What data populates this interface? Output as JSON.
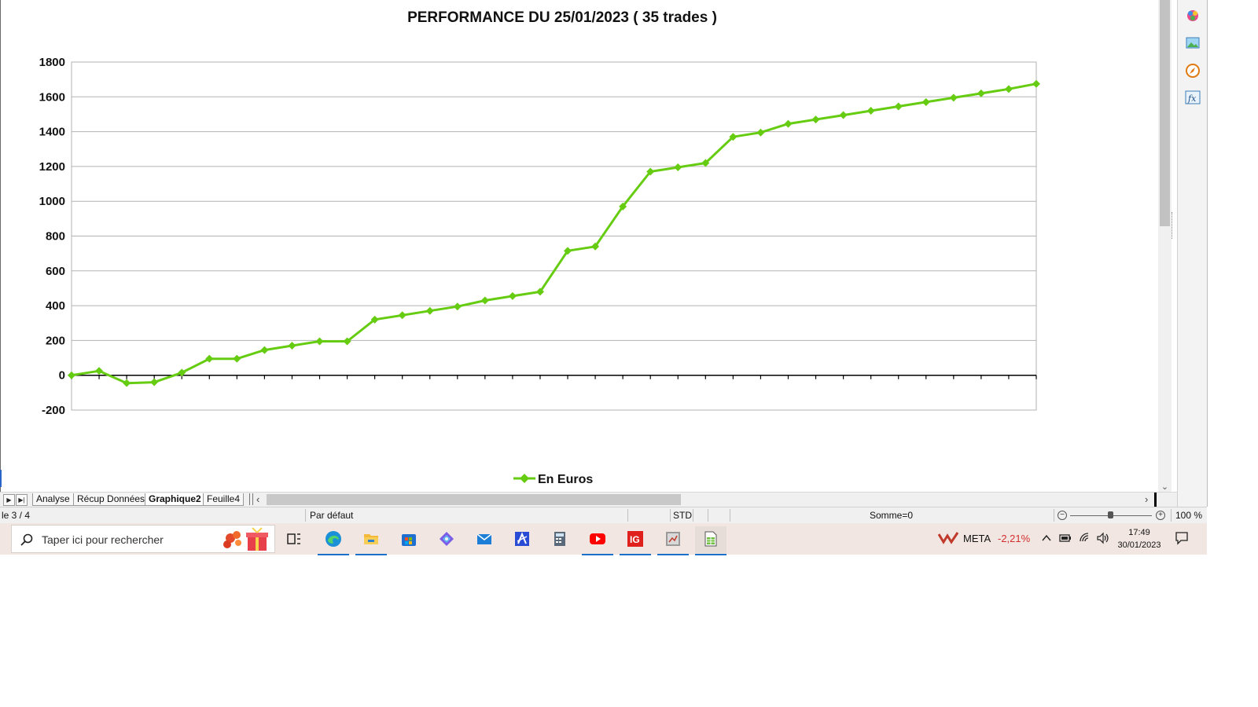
{
  "chart_data": {
    "type": "line",
    "title": "PERFORMANCE DU 25/01/2023 ( 35 trades )",
    "xlabel": "",
    "ylabel": "",
    "ylim": [
      -200,
      1800
    ],
    "yticks": [
      1800,
      1600,
      1400,
      1200,
      1000,
      800,
      600,
      400,
      200,
      0,
      -200
    ],
    "grid": true,
    "legend_position": "bottom-center",
    "series": [
      {
        "name": "En Euros",
        "color": "#66cc11",
        "marker": "diamond",
        "x": [
          1,
          2,
          3,
          4,
          5,
          6,
          7,
          8,
          9,
          10,
          11,
          12,
          13,
          14,
          15,
          16,
          17,
          18,
          19,
          20,
          21,
          22,
          23,
          24,
          25,
          26,
          27,
          28,
          29,
          30,
          31,
          32,
          33,
          34,
          35,
          36
        ],
        "values": [
          0,
          25,
          -45,
          -40,
          15,
          95,
          95,
          145,
          170,
          195,
          195,
          320,
          345,
          370,
          395,
          430,
          455,
          480,
          715,
          740,
          970,
          1170,
          1195,
          1220,
          1370,
          1395,
          1445,
          1470,
          1495,
          1520,
          1545,
          1570,
          1595,
          1620,
          1645,
          1675
        ]
      }
    ]
  },
  "sheet_tabs": {
    "tabs": [
      "Analyse",
      "Récup Données",
      "Graphique2",
      "Feuille4"
    ],
    "active": "Graphique2"
  },
  "statusbar": {
    "sheet_info": "le 3 / 4",
    "page_style": "Par défaut",
    "mode": "STD",
    "sum": "Somme=0",
    "zoom": "100 %"
  },
  "taskbar": {
    "search_placeholder": "Taper ici pour rechercher",
    "apps": [
      "task-view",
      "edge",
      "file-explorer",
      "store",
      "copilot",
      "mail",
      "app-a",
      "calculator",
      "youtube",
      "ig",
      "photos",
      "calc-spreadsheet"
    ],
    "stock_name": "META",
    "stock_change": "-2,21%",
    "time": "17:49",
    "date": "30/01/2023"
  }
}
